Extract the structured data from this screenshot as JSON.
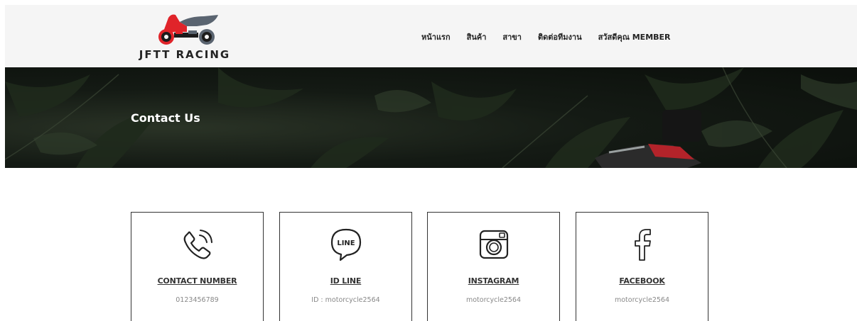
{
  "header": {
    "brand": "JFTT RACING",
    "nav": [
      {
        "label": "หน้าแรก"
      },
      {
        "label": "สินค้า"
      },
      {
        "label": "สาขา"
      },
      {
        "label": "ติดต่อทีมงาน"
      },
      {
        "label": "สวัสดีคุณ MEMBER"
      }
    ]
  },
  "hero": {
    "title": "Contact Us"
  },
  "cards": [
    {
      "icon": "phone-icon",
      "title": "CONTACT NUMBER",
      "value": "0123456789"
    },
    {
      "icon": "line-icon",
      "icon_text": "LINE",
      "title": "ID LINE",
      "value": "ID : motorcycle2564"
    },
    {
      "icon": "instagram-icon",
      "title": "INSTAGRAM",
      "value": "motorcycle2564"
    },
    {
      "icon": "facebook-icon",
      "title": "FACEBOOK",
      "value": "motorcycle2564"
    }
  ],
  "colors": {
    "header_bg": "#f5f5f5",
    "logo_red": "#e0242a",
    "logo_gray": "#5a6470",
    "text_dark": "#222222",
    "muted": "#888888"
  }
}
